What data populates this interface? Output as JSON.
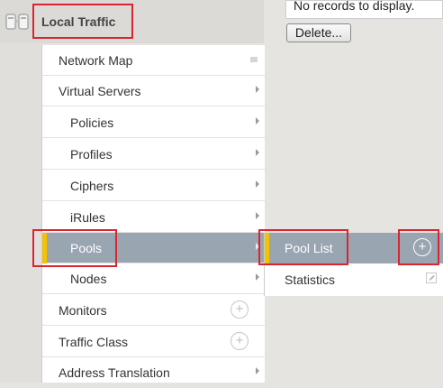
{
  "header": {
    "title": "Local Traffic"
  },
  "table": {
    "empty_message": "No records to display."
  },
  "buttons": {
    "delete": "Delete..."
  },
  "menu": {
    "items": [
      {
        "label": "Network Map"
      },
      {
        "label": "Virtual Servers"
      },
      {
        "label": "Policies"
      },
      {
        "label": "Profiles"
      },
      {
        "label": "Ciphers"
      },
      {
        "label": "iRules"
      },
      {
        "label": "Pools"
      },
      {
        "label": "Nodes"
      },
      {
        "label": "Monitors"
      },
      {
        "label": "Traffic Class"
      },
      {
        "label": "Address Translation"
      }
    ]
  },
  "submenu": {
    "items": [
      {
        "label": "Pool List"
      },
      {
        "label": "Statistics"
      }
    ]
  },
  "colors": {
    "selected_bg": "#9aa5b2",
    "selected_marker": "#f3c200",
    "highlight_box": "#d9252f"
  }
}
